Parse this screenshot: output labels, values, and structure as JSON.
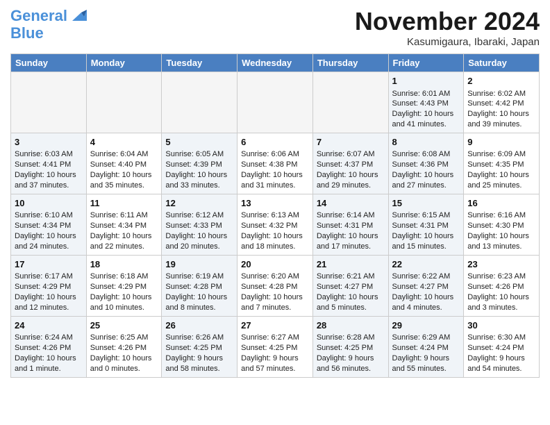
{
  "header": {
    "logo_line1": "General",
    "logo_line2": "Blue",
    "month": "November 2024",
    "location": "Kasumigaura, Ibaraki, Japan"
  },
  "days_of_week": [
    "Sunday",
    "Monday",
    "Tuesday",
    "Wednesday",
    "Thursday",
    "Friday",
    "Saturday"
  ],
  "weeks": [
    [
      {
        "day": "",
        "info": "",
        "empty": true
      },
      {
        "day": "",
        "info": "",
        "empty": true
      },
      {
        "day": "",
        "info": "",
        "empty": true
      },
      {
        "day": "",
        "info": "",
        "empty": true
      },
      {
        "day": "",
        "info": "",
        "empty": true
      },
      {
        "day": "1",
        "info": "Sunrise: 6:01 AM\nSunset: 4:43 PM\nDaylight: 10 hours and 41 minutes.",
        "shaded": true
      },
      {
        "day": "2",
        "info": "Sunrise: 6:02 AM\nSunset: 4:42 PM\nDaylight: 10 hours and 39 minutes.",
        "shaded": false
      }
    ],
    [
      {
        "day": "3",
        "info": "Sunrise: 6:03 AM\nSunset: 4:41 PM\nDaylight: 10 hours and 37 minutes.",
        "shaded": true
      },
      {
        "day": "4",
        "info": "Sunrise: 6:04 AM\nSunset: 4:40 PM\nDaylight: 10 hours and 35 minutes.",
        "shaded": false
      },
      {
        "day": "5",
        "info": "Sunrise: 6:05 AM\nSunset: 4:39 PM\nDaylight: 10 hours and 33 minutes.",
        "shaded": true
      },
      {
        "day": "6",
        "info": "Sunrise: 6:06 AM\nSunset: 4:38 PM\nDaylight: 10 hours and 31 minutes.",
        "shaded": false
      },
      {
        "day": "7",
        "info": "Sunrise: 6:07 AM\nSunset: 4:37 PM\nDaylight: 10 hours and 29 minutes.",
        "shaded": true
      },
      {
        "day": "8",
        "info": "Sunrise: 6:08 AM\nSunset: 4:36 PM\nDaylight: 10 hours and 27 minutes.",
        "shaded": true
      },
      {
        "day": "9",
        "info": "Sunrise: 6:09 AM\nSunset: 4:35 PM\nDaylight: 10 hours and 25 minutes.",
        "shaded": false
      }
    ],
    [
      {
        "day": "10",
        "info": "Sunrise: 6:10 AM\nSunset: 4:34 PM\nDaylight: 10 hours and 24 minutes.",
        "shaded": true
      },
      {
        "day": "11",
        "info": "Sunrise: 6:11 AM\nSunset: 4:34 PM\nDaylight: 10 hours and 22 minutes.",
        "shaded": false
      },
      {
        "day": "12",
        "info": "Sunrise: 6:12 AM\nSunset: 4:33 PM\nDaylight: 10 hours and 20 minutes.",
        "shaded": true
      },
      {
        "day": "13",
        "info": "Sunrise: 6:13 AM\nSunset: 4:32 PM\nDaylight: 10 hours and 18 minutes.",
        "shaded": false
      },
      {
        "day": "14",
        "info": "Sunrise: 6:14 AM\nSunset: 4:31 PM\nDaylight: 10 hours and 17 minutes.",
        "shaded": true
      },
      {
        "day": "15",
        "info": "Sunrise: 6:15 AM\nSunset: 4:31 PM\nDaylight: 10 hours and 15 minutes.",
        "shaded": true
      },
      {
        "day": "16",
        "info": "Sunrise: 6:16 AM\nSunset: 4:30 PM\nDaylight: 10 hours and 13 minutes.",
        "shaded": false
      }
    ],
    [
      {
        "day": "17",
        "info": "Sunrise: 6:17 AM\nSunset: 4:29 PM\nDaylight: 10 hours and 12 minutes.",
        "shaded": true
      },
      {
        "day": "18",
        "info": "Sunrise: 6:18 AM\nSunset: 4:29 PM\nDaylight: 10 hours and 10 minutes.",
        "shaded": false
      },
      {
        "day": "19",
        "info": "Sunrise: 6:19 AM\nSunset: 4:28 PM\nDaylight: 10 hours and 8 minutes.",
        "shaded": true
      },
      {
        "day": "20",
        "info": "Sunrise: 6:20 AM\nSunset: 4:28 PM\nDaylight: 10 hours and 7 minutes.",
        "shaded": false
      },
      {
        "day": "21",
        "info": "Sunrise: 6:21 AM\nSunset: 4:27 PM\nDaylight: 10 hours and 5 minutes.",
        "shaded": true
      },
      {
        "day": "22",
        "info": "Sunrise: 6:22 AM\nSunset: 4:27 PM\nDaylight: 10 hours and 4 minutes.",
        "shaded": true
      },
      {
        "day": "23",
        "info": "Sunrise: 6:23 AM\nSunset: 4:26 PM\nDaylight: 10 hours and 3 minutes.",
        "shaded": false
      }
    ],
    [
      {
        "day": "24",
        "info": "Sunrise: 6:24 AM\nSunset: 4:26 PM\nDaylight: 10 hours and 1 minute.",
        "shaded": true
      },
      {
        "day": "25",
        "info": "Sunrise: 6:25 AM\nSunset: 4:26 PM\nDaylight: 10 hours and 0 minutes.",
        "shaded": false
      },
      {
        "day": "26",
        "info": "Sunrise: 6:26 AM\nSunset: 4:25 PM\nDaylight: 9 hours and 58 minutes.",
        "shaded": true
      },
      {
        "day": "27",
        "info": "Sunrise: 6:27 AM\nSunset: 4:25 PM\nDaylight: 9 hours and 57 minutes.",
        "shaded": false
      },
      {
        "day": "28",
        "info": "Sunrise: 6:28 AM\nSunset: 4:25 PM\nDaylight: 9 hours and 56 minutes.",
        "shaded": true
      },
      {
        "day": "29",
        "info": "Sunrise: 6:29 AM\nSunset: 4:24 PM\nDaylight: 9 hours and 55 minutes.",
        "shaded": true
      },
      {
        "day": "30",
        "info": "Sunrise: 6:30 AM\nSunset: 4:24 PM\nDaylight: 9 hours and 54 minutes.",
        "shaded": false
      }
    ]
  ]
}
